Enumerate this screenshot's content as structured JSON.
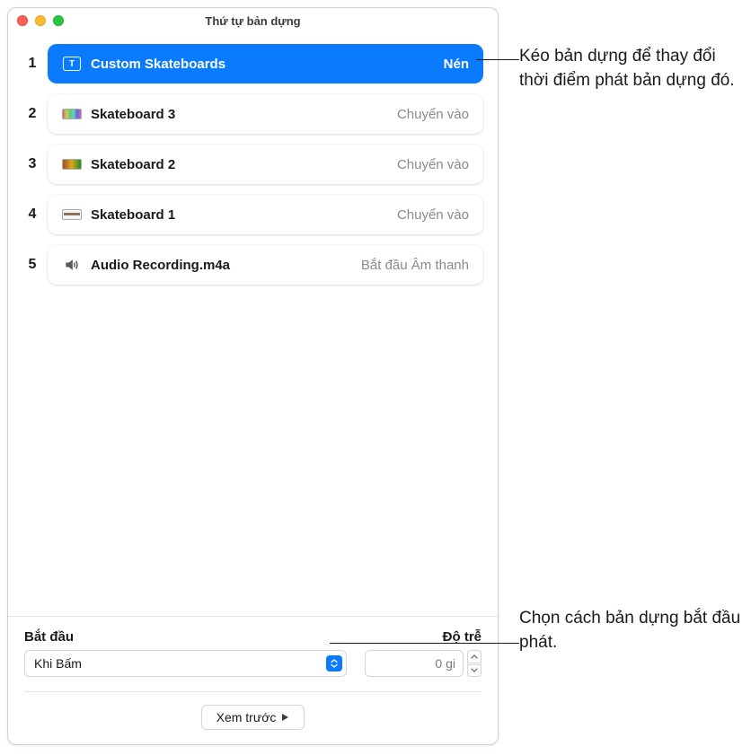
{
  "window": {
    "title": "Thứ tự bản dựng"
  },
  "builds": [
    {
      "num": "1",
      "label": "Custom Skateboards",
      "effect": "Nén",
      "icon": "text",
      "selected": true
    },
    {
      "num": "2",
      "label": "Skateboard 3",
      "effect": "Chuyển vào",
      "icon": "thumb1",
      "selected": false
    },
    {
      "num": "3",
      "label": "Skateboard 2",
      "effect": "Chuyển vào",
      "icon": "thumb2",
      "selected": false
    },
    {
      "num": "4",
      "label": "Skateboard 1",
      "effect": "Chuyển vào",
      "icon": "thumb3",
      "selected": false
    },
    {
      "num": "5",
      "label": "Audio Recording.m4a",
      "effect": "Bắt đầu Âm thanh",
      "icon": "audio",
      "selected": false
    }
  ],
  "controls": {
    "start_label": "Bắt đầu",
    "start_value": "Khi Bấm",
    "delay_label": "Độ trễ",
    "delay_value": "0 gi",
    "preview_label": "Xem trước"
  },
  "callouts": {
    "drag": "Kéo bản dựng để thay đổi thời điểm phát bản dựng đó.",
    "start": "Chọn cách bản dựng bắt đầu phát."
  }
}
